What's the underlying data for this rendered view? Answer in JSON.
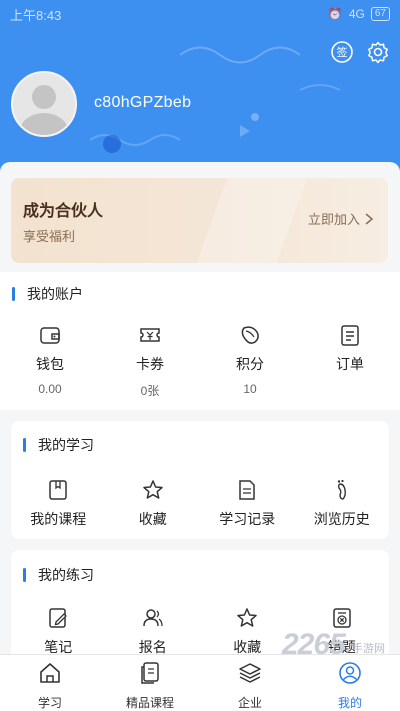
{
  "status_bar": {
    "time": "上午8:43",
    "network": "4G",
    "battery": "67"
  },
  "header": {
    "sign_icon_text": "签",
    "username": "c80hGPZbeb"
  },
  "partner": {
    "title": "成为合伙人",
    "subtitle": "享受福利",
    "join": "立即加入"
  },
  "account": {
    "title": "我的账户",
    "items": [
      {
        "label": "钱包",
        "value": "0.00",
        "icon": "wallet-icon"
      },
      {
        "label": "卡券",
        "value": "0张",
        "icon": "coupon-icon"
      },
      {
        "label": "积分",
        "value": "10",
        "icon": "points-icon"
      },
      {
        "label": "订单",
        "value": "",
        "icon": "order-icon"
      }
    ]
  },
  "study": {
    "title": "我的学习",
    "items": [
      {
        "label": "我的课程",
        "icon": "course-icon"
      },
      {
        "label": "收藏",
        "icon": "star-icon"
      },
      {
        "label": "学习记录",
        "icon": "record-icon"
      },
      {
        "label": "浏览历史",
        "icon": "footprint-icon"
      }
    ]
  },
  "practice": {
    "title": "我的练习",
    "items": [
      {
        "label": "笔记",
        "icon": "note-icon"
      },
      {
        "label": "报名",
        "icon": "signup-icon"
      },
      {
        "label": "收藏",
        "icon": "star-icon"
      },
      {
        "label": "错题",
        "icon": "wrong-question-icon"
      }
    ]
  },
  "tabbar": {
    "tabs": [
      {
        "label": "学习",
        "icon": "home-icon"
      },
      {
        "label": "精品课程",
        "icon": "course-book-icon"
      },
      {
        "label": "企业",
        "icon": "layers-icon"
      },
      {
        "label": "我的",
        "icon": "profile-icon"
      }
    ],
    "active_index": 3
  },
  "watermark": {
    "brand": "2265",
    "suffix": "手游网"
  },
  "colors": {
    "header_blue": "#3d8ff0",
    "accent": "#2d7be5",
    "partner_gold": "#f3e2cf"
  }
}
